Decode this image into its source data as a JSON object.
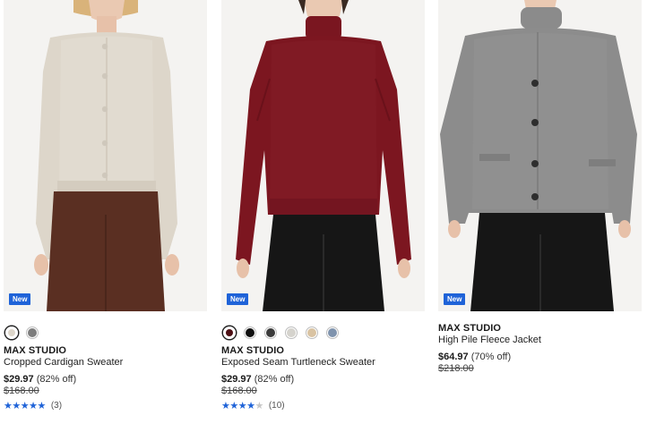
{
  "products": [
    {
      "badge": "New",
      "swatches": [
        "#ddd6ca",
        "#7d7d7d"
      ],
      "brand": "MAX STUDIO",
      "title": "Cropped Cardigan Sweater",
      "price": "$29.97",
      "percent_off": "(82% off)",
      "was_price": "$168.00",
      "rating": 5,
      "review_count": "(3)"
    },
    {
      "badge": "New",
      "swatches": [
        "#4d0f14",
        "#101010",
        "#3b3b3b",
        "#d5d3cd",
        "#d9c3a2",
        "#7f93ad"
      ],
      "brand": "MAX STUDIO",
      "title": "Exposed Seam Turtleneck Sweater",
      "price": "$29.97",
      "percent_off": "(82% off)",
      "was_price": "$168.00",
      "rating": 4.5,
      "review_count": "(10)"
    },
    {
      "badge": "New",
      "swatches": [],
      "brand": "MAX STUDIO",
      "title": "High Pile Fleece Jacket",
      "price": "$64.97",
      "percent_off": "(70% off)",
      "was_price": "$218.00"
    }
  ]
}
